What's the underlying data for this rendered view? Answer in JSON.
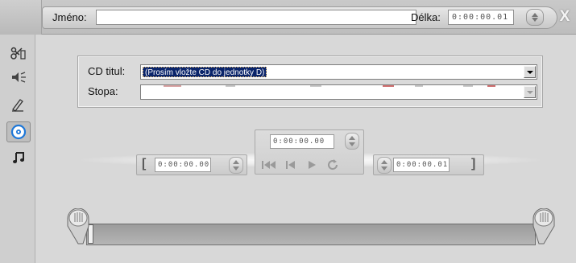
{
  "header": {
    "name_label": "Jméno:",
    "name_value": "",
    "length_label": "Délka:",
    "length_value": "0:00:00.01",
    "close_label": "X"
  },
  "sidebar": {
    "items": [
      {
        "icon": "scissors-icon",
        "active": false
      },
      {
        "icon": "volume-icon",
        "active": false
      },
      {
        "icon": "pen-icon",
        "active": false
      },
      {
        "icon": "cd-icon",
        "active": true
      },
      {
        "icon": "music-note-icon",
        "active": false
      }
    ]
  },
  "cd": {
    "title_label": "CD titul:",
    "title_value": "(Prosím vložte CD do jednotky D)",
    "track_label": "Stopa:",
    "track_value": ""
  },
  "transport": {
    "current_time": "0:00:00.00",
    "in_time": "0:00:00.00",
    "out_time": "0:00:00.01",
    "in_bracket": "[",
    "out_bracket": "]"
  },
  "colors": {
    "selection": "#0a246a",
    "accent_cd": "#1f78d8"
  }
}
